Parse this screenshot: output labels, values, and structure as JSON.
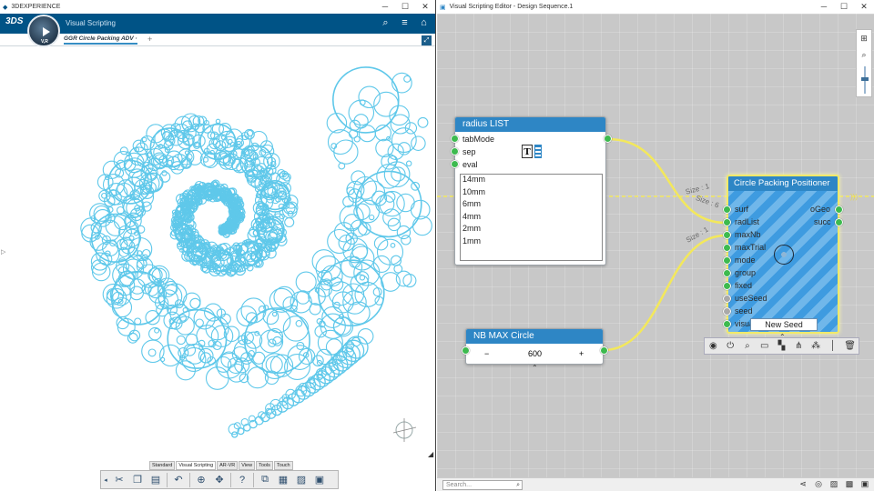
{
  "left_window": {
    "title": "3DEXPERIENCE",
    "controls": {
      "minimize": "─",
      "maximize": "☐",
      "close": "✕"
    },
    "app_name": "Visual Scripting",
    "compass_version": "V,R",
    "logo": "3DS",
    "tab_label": "GGR Circle Packing ADV ·",
    "tab_add": "+",
    "toolbar_tabs": [
      "Standard",
      "Visual Scripting",
      "AR-VR",
      "View",
      "Tools",
      "Touch"
    ],
    "active_toolbar_tab": "Visual Scripting",
    "action_icons": [
      "scissors-icon",
      "copy-icon",
      "paste-icon",
      "undo-icon",
      "zoom-fit-icon",
      "transform-icon",
      "help-icon",
      "graph-icon",
      "table-icon",
      "chart-icon",
      "monitor-icon"
    ]
  },
  "right_window": {
    "title": "Visual Scripting Editor - Design Sequence.1",
    "controls": {
      "minimize": "─",
      "maximize": "☐",
      "close": "✕"
    },
    "search_placeholder": "Search...",
    "nodes": {
      "radius_list": {
        "title": "radius LIST",
        "ports_in": [
          "tabMode",
          "sep",
          "eval"
        ],
        "items": [
          "14mm",
          "10mm",
          "6mm",
          "4mm",
          "2mm",
          "1mm"
        ]
      },
      "nb_max": {
        "title": "NB MAX Circle",
        "minus": "−",
        "value": "600",
        "plus": "+"
      },
      "circle_packing": {
        "title": "Circle Packing Positioner",
        "ports_in": [
          "surf",
          "radList",
          "maxNb",
          "maxTrial",
          "mode",
          "group",
          "fixed",
          "useSeed",
          "seed",
          "visualize"
        ],
        "ports_out": [
          "oGeo",
          "succ"
        ],
        "button": "New Seed"
      }
    },
    "wire_labels": [
      "Size : 1",
      "Size : 6",
      "Size : 1"
    ]
  },
  "colors": {
    "app_header": "#005386",
    "node_header": "#2e86c5",
    "port_green": "#3dba4f",
    "wire_yellow": "#f3e85b",
    "circle_stroke": "#5fc8ea"
  }
}
